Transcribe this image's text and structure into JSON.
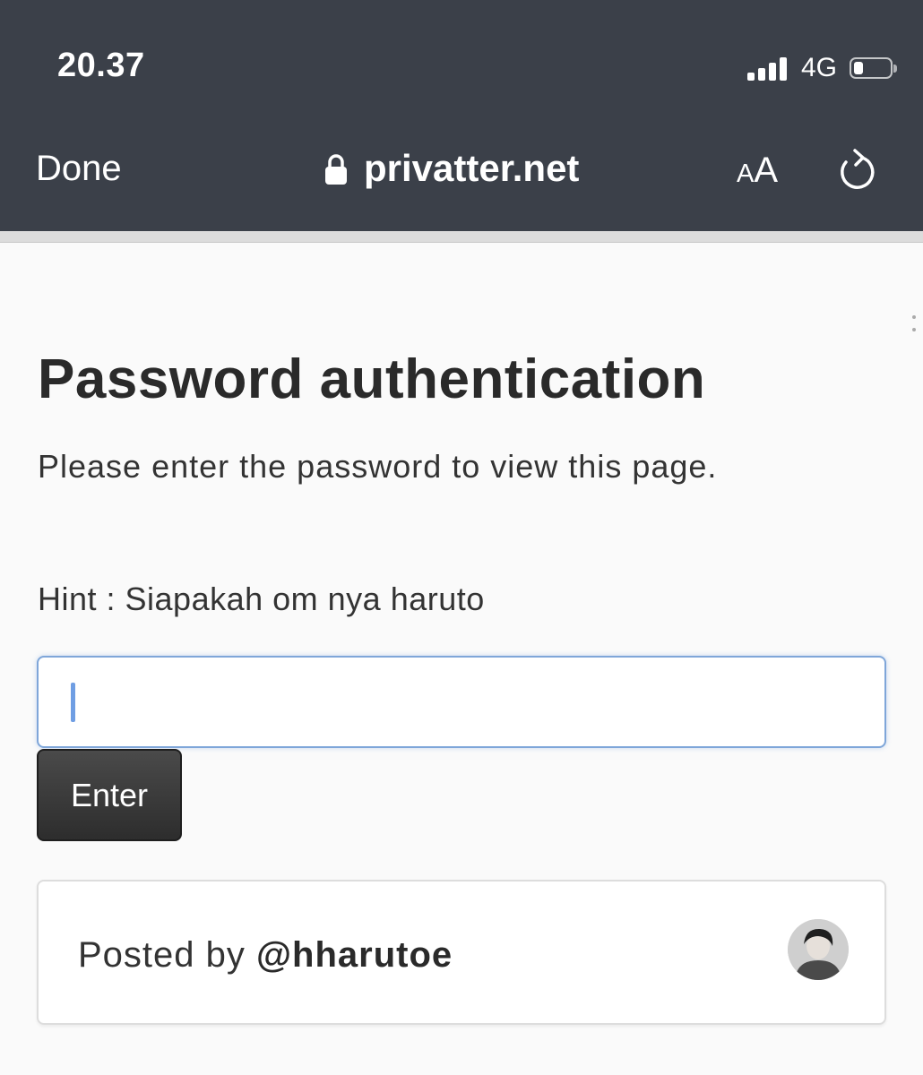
{
  "status_bar": {
    "time": "20.37",
    "network": "4G",
    "battery_level": 0.25
  },
  "browser": {
    "done_label": "Done",
    "url": "privatter.net",
    "text_size_small": "A",
    "text_size_large": "A",
    "icons": [
      "lock-icon",
      "reload-icon",
      "signal-icon",
      "battery-icon"
    ]
  },
  "page": {
    "title": "Password authentication",
    "description": "Please enter the password to view this page.",
    "hint": "Hint : Siapakah om nya haruto",
    "password_value": "",
    "enter_label": "Enter",
    "posted_by_label": "Posted by",
    "author": "@hharutoe"
  },
  "colors": {
    "top_bar": "#3b4049",
    "input_focus_border": "#7fa6d9",
    "button_bg": "#3a3a3a"
  }
}
